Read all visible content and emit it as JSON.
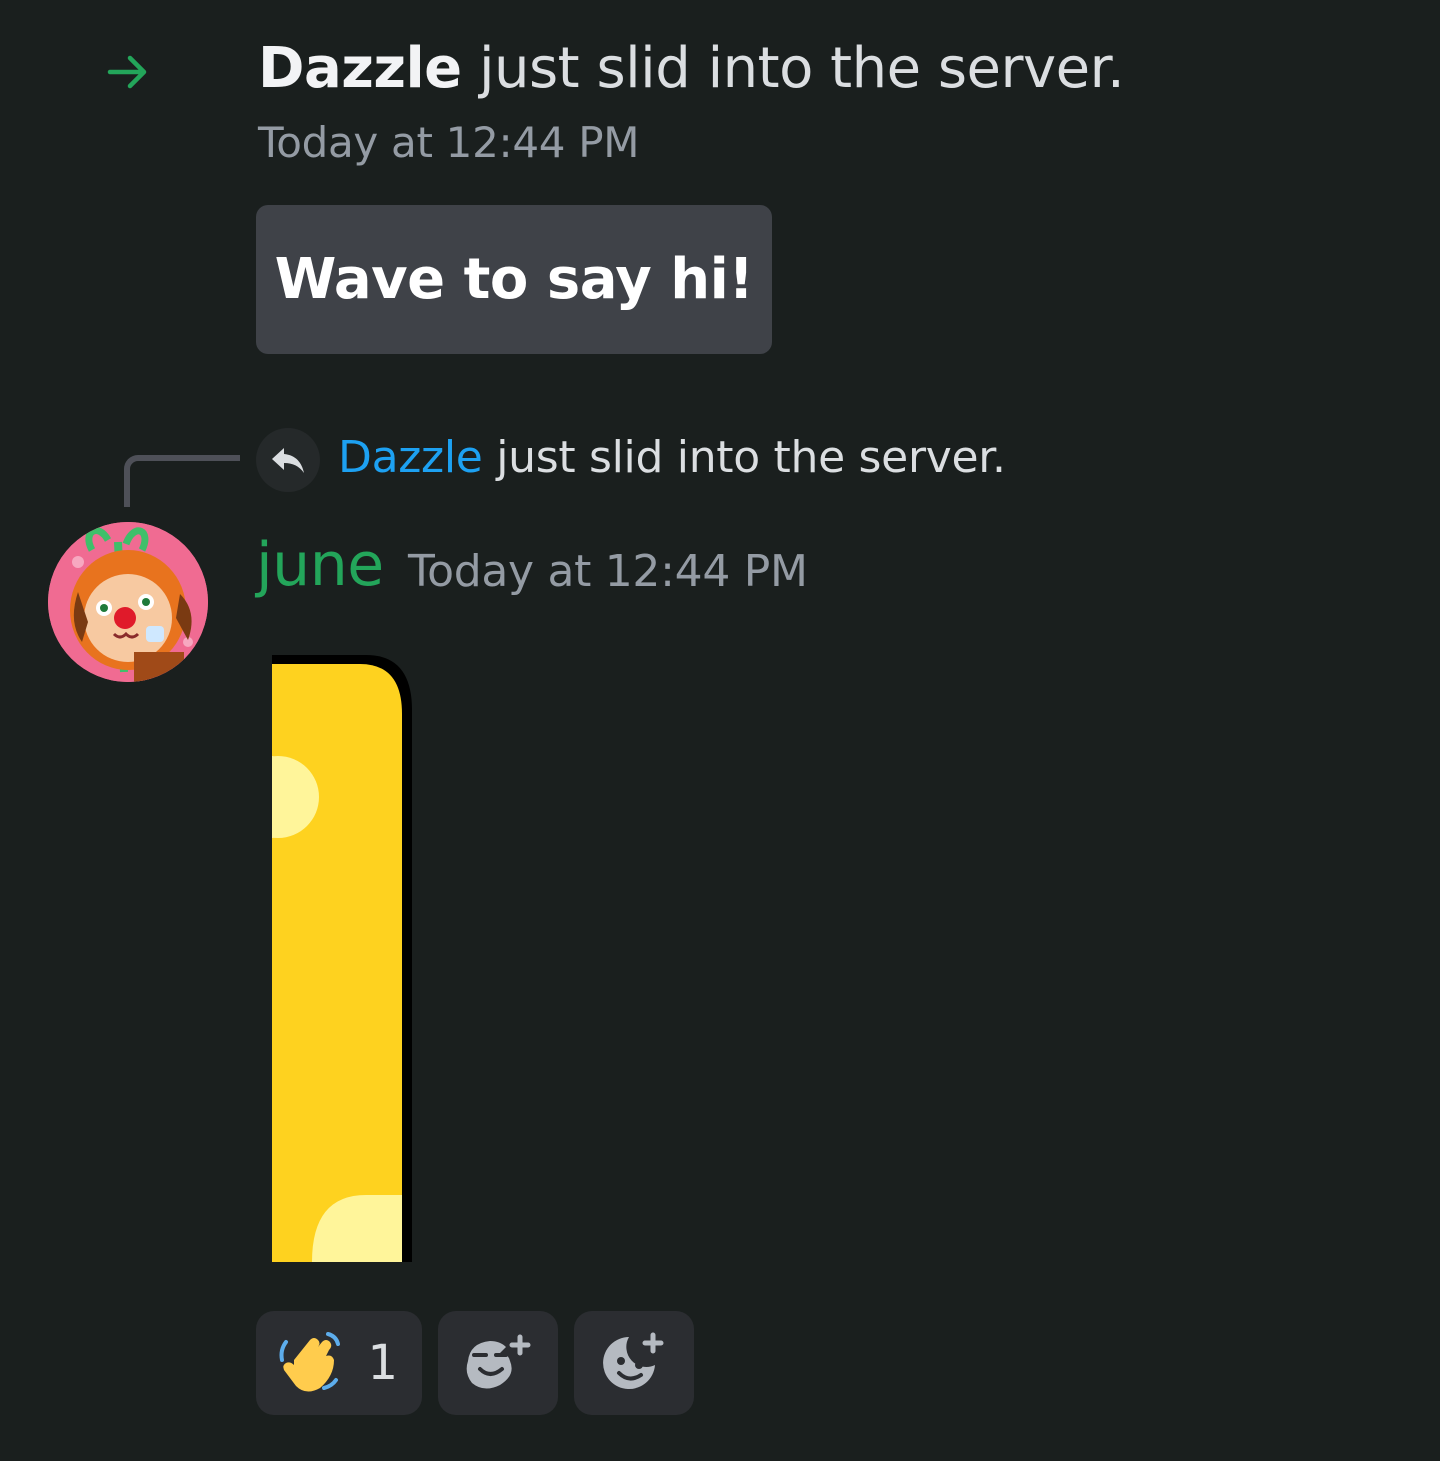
{
  "join_message": {
    "username": "Dazzle",
    "text": "just slid into the server.",
    "timestamp": "Today at 12:44 PM",
    "icon": "arrow-right-icon",
    "accent_color": "#23a55a"
  },
  "wave_button": {
    "label": "Wave to say hi!"
  },
  "reply_preview": {
    "username": "Dazzle",
    "text": "just slid into the server.",
    "icon": "reply-icon",
    "username_color": "#1da1f2"
  },
  "message": {
    "author": "june",
    "author_color": "#23a55a",
    "timestamp": "Today at 12:44 PM",
    "avatar": "avatar-image",
    "attachment": "sticker-image"
  },
  "reactions": [
    {
      "emoji": "👋",
      "icon": "waving-hand-icon",
      "count": "1"
    },
    {
      "icon": "add-super-reaction-icon"
    },
    {
      "icon": "add-reaction-icon"
    }
  ]
}
